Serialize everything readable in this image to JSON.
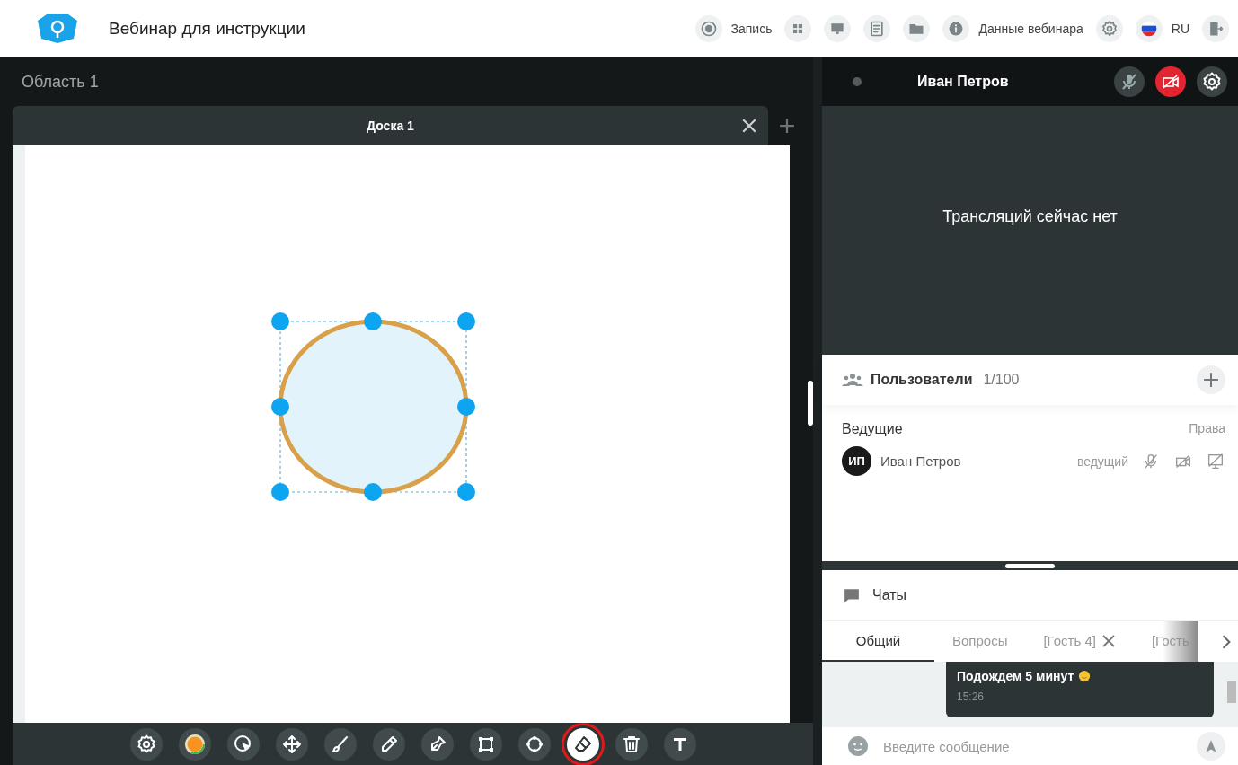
{
  "header": {
    "title": "Вебинар для инструкции",
    "items": [
      {
        "kind": "record",
        "label": "Запись"
      },
      {
        "kind": "apps"
      },
      {
        "kind": "screen"
      },
      {
        "kind": "document"
      },
      {
        "kind": "folder"
      },
      {
        "kind": "info",
        "label": "Данные вебинара"
      },
      {
        "kind": "settings"
      },
      {
        "kind": "language",
        "label": "RU"
      },
      {
        "kind": "exit"
      }
    ]
  },
  "workspace": {
    "title": "Область 1",
    "board_tab": "Доска 1"
  },
  "toolbar": [
    {
      "kind": "settings",
      "selected": false
    },
    {
      "kind": "color",
      "selected": false
    },
    {
      "kind": "pointer",
      "selected": false
    },
    {
      "kind": "move",
      "selected": false
    },
    {
      "kind": "brush",
      "selected": false
    },
    {
      "kind": "pencil",
      "selected": false
    },
    {
      "kind": "pen",
      "selected": false
    },
    {
      "kind": "rectangle",
      "selected": false
    },
    {
      "kind": "circle",
      "selected": false
    },
    {
      "kind": "eraser",
      "selected": true
    },
    {
      "kind": "trash",
      "selected": false
    },
    {
      "kind": "text",
      "selected": false
    }
  ],
  "video": {
    "name": "Иван Петров",
    "camera_off": true,
    "message": "Трансляций сейчас нет"
  },
  "users": {
    "title": "Пользователи",
    "count": "1/100",
    "group": "Ведущие",
    "rights": "Права",
    "members": [
      {
        "initials": "ИП",
        "name": "Иван Петров",
        "role": "ведущий"
      }
    ]
  },
  "chats": {
    "title": "Чаты",
    "tabs": [
      {
        "label": "Общий",
        "selected": true,
        "closable": false
      },
      {
        "label": "Вопросы",
        "selected": false,
        "closable": false
      },
      {
        "label": "[Гость 4]",
        "selected": false,
        "closable": true
      },
      {
        "label": "[Гость",
        "selected": false,
        "closable": false
      }
    ],
    "messages": [
      {
        "text": "Подождем 5 минут",
        "time": "15:26"
      }
    ],
    "placeholder": "Введите сообщение"
  }
}
